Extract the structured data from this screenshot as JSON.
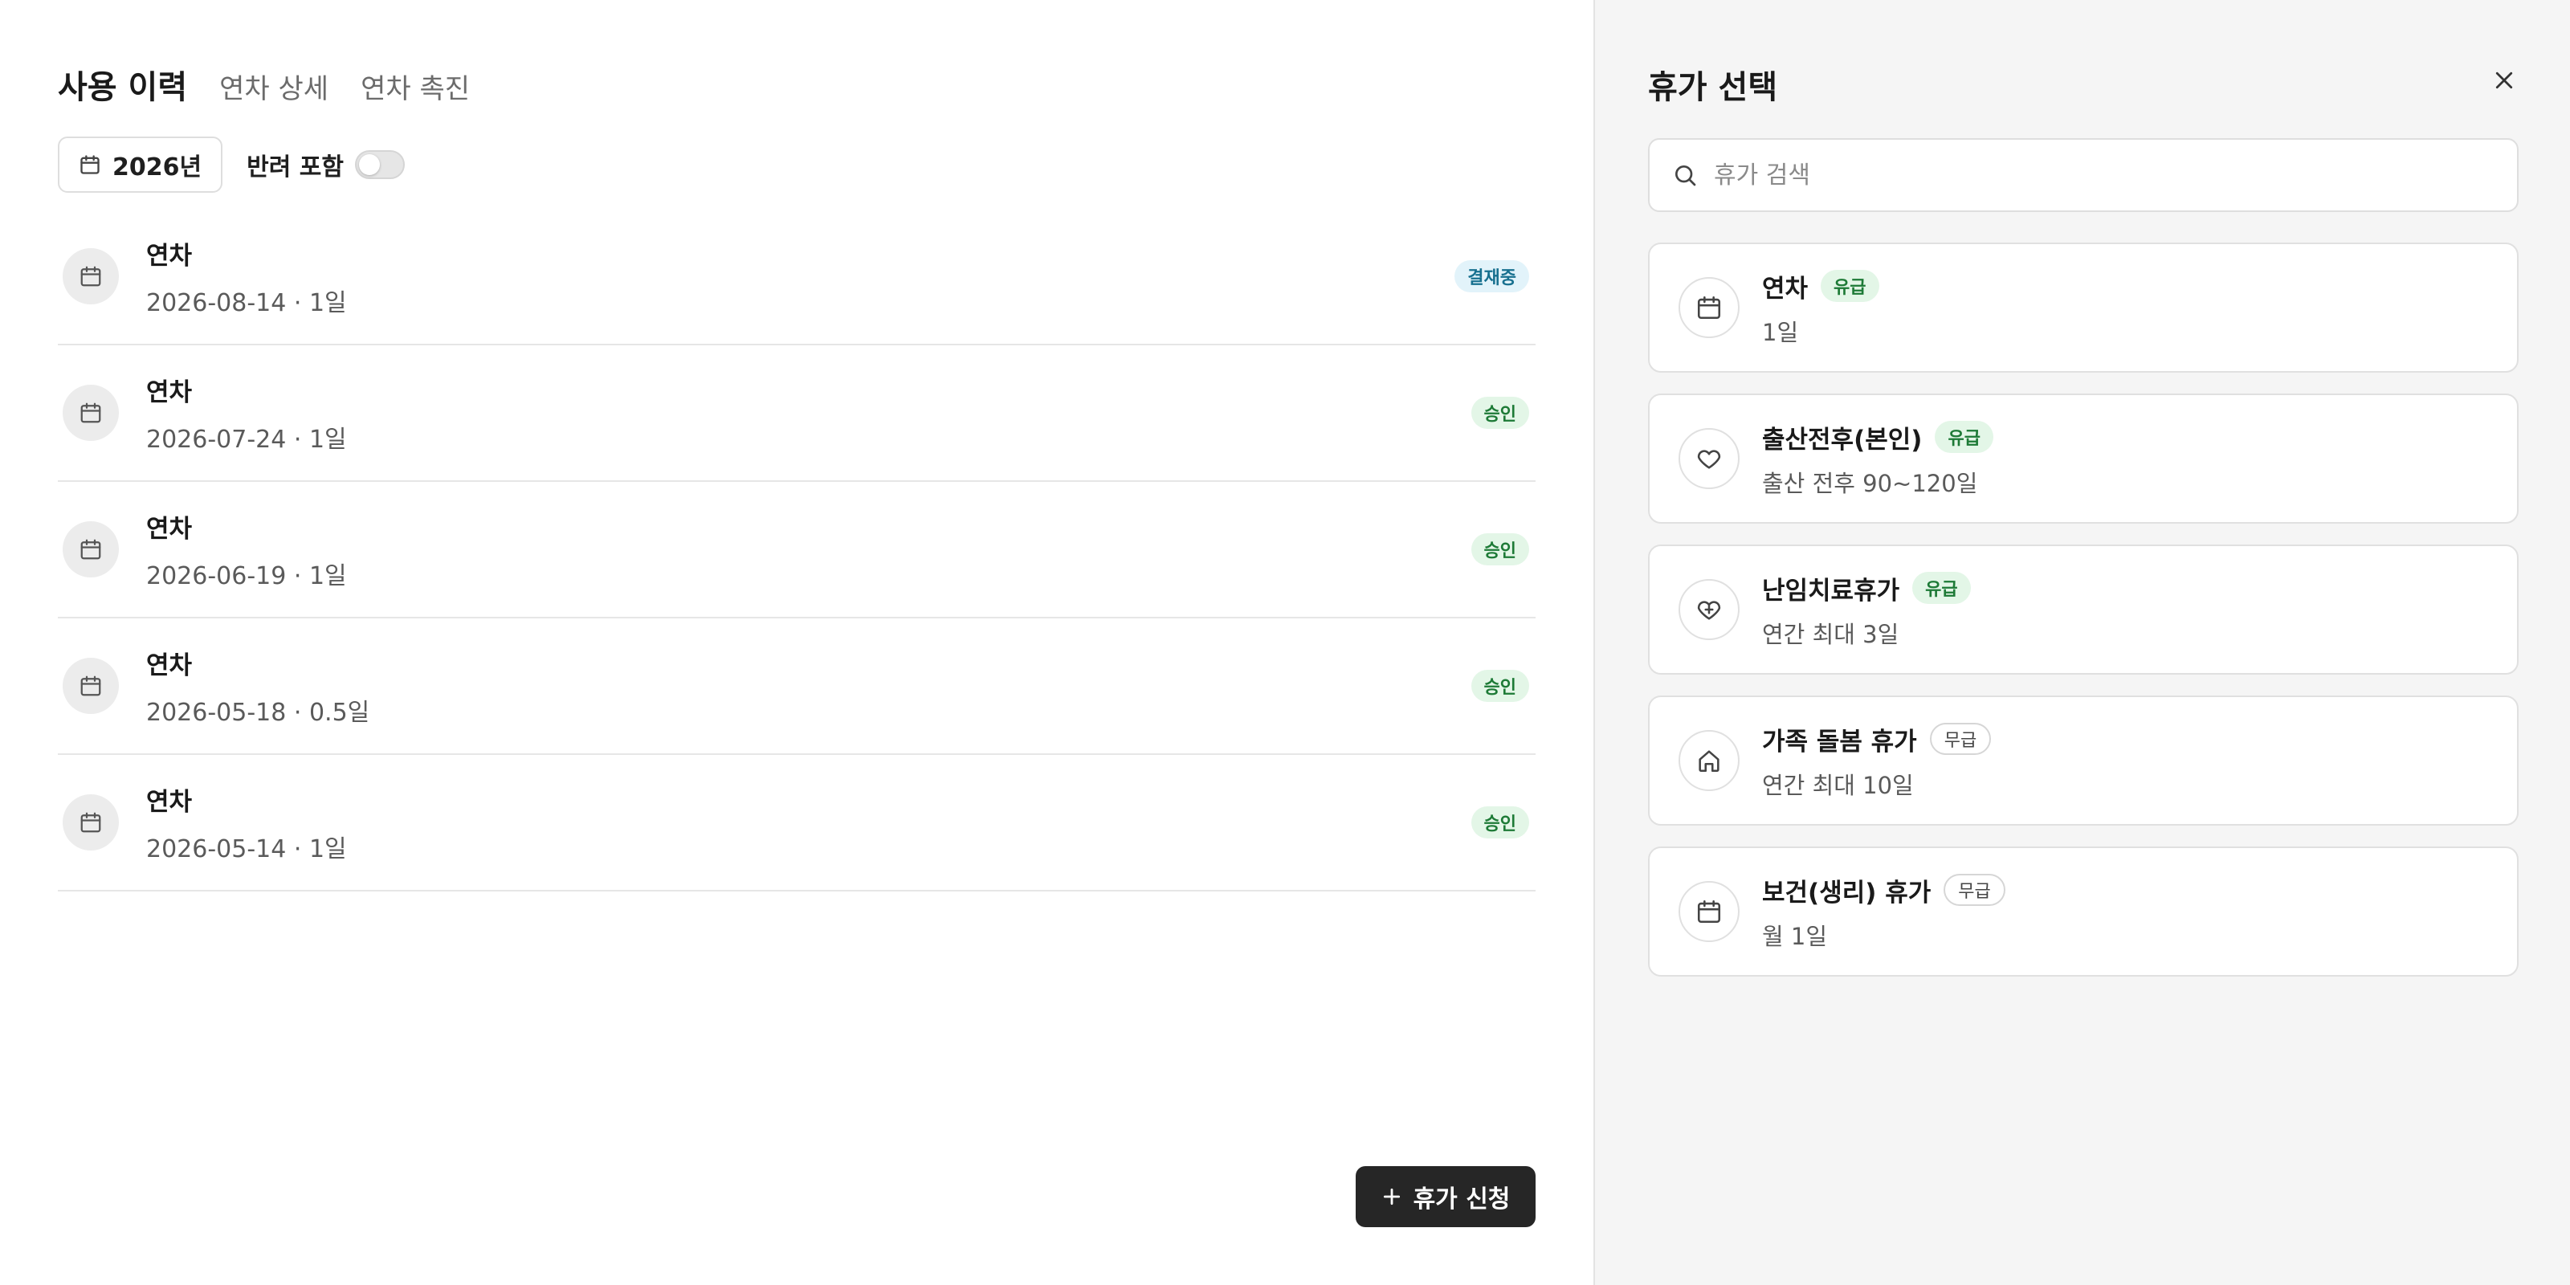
{
  "tabs": [
    "사용 이력",
    "연차 상세",
    "연차 촉진"
  ],
  "filters": {
    "year_label": "2026년",
    "pet_label": "반려 포함",
    "pet_toggle_on": false
  },
  "history": [
    {
      "title": "연차",
      "subtitle": "2026-08-14 · 1일",
      "status": "결재중",
      "status_type": "pending"
    },
    {
      "title": "연차",
      "subtitle": "2026-07-24 · 1일",
      "status": "승인",
      "status_type": "approved"
    },
    {
      "title": "연차",
      "subtitle": "2026-06-19 · 1일",
      "status": "승인",
      "status_type": "approved"
    },
    {
      "title": "연차",
      "subtitle": "2026-05-18 · 0.5일",
      "status": "승인",
      "status_type": "approved"
    },
    {
      "title": "연차",
      "subtitle": "2026-05-14 · 1일",
      "status": "승인",
      "status_type": "approved"
    }
  ],
  "apply_button": "휴가 신청",
  "panel": {
    "title": "휴가 선택",
    "search_placeholder": "휴가 검색",
    "items": [
      {
        "title": "연차",
        "badge": "유급",
        "paid": true,
        "desc": "1일",
        "icon": "calendar-icon"
      },
      {
        "title": "출산전후(본인)",
        "badge": "유급",
        "paid": true,
        "desc": "출산 전후 90~120일",
        "icon": "heart-icon"
      },
      {
        "title": "난임치료휴가",
        "badge": "유급",
        "paid": true,
        "desc": "연간 최대 3일",
        "icon": "heart-plus-icon"
      },
      {
        "title": "가족 돌봄 휴가",
        "badge": "무급",
        "paid": false,
        "desc": "연간 최대 10일",
        "icon": "home-icon"
      },
      {
        "title": "보건(생리) 휴가",
        "badge": "무급",
        "paid": false,
        "desc": "월 1일",
        "icon": "calendar-icon"
      }
    ]
  },
  "colors": {
    "accent_dark": "#262626",
    "pending_bg": "#e2f3fa",
    "pending_text": "#17708f",
    "approved_bg": "#e3f6e7",
    "approved_text": "#1d7a36"
  }
}
